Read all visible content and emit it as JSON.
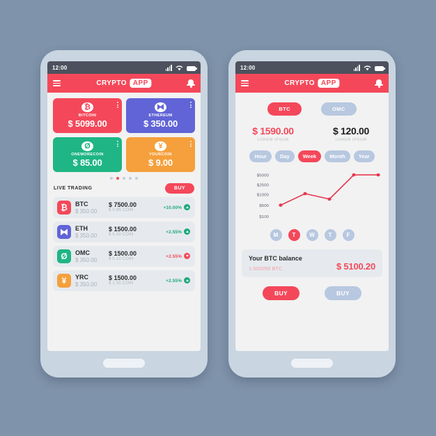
{
  "statusbar": {
    "time": "12:00",
    "signal_icon": "signal-bars-icon",
    "wifi_icon": "wifi-icon",
    "battery_icon": "battery-icon"
  },
  "header": {
    "menu_icon": "hamburger-menu-icon",
    "brand_first": "CRYPTO",
    "brand_second": "APP",
    "bell_icon": "notification-bell-icon"
  },
  "colors": {
    "accent_red": "#f4485a",
    "blue": "#b7c8e0",
    "green": "#1fa87a",
    "purple": "#6164d6",
    "orange": "#f5a03c",
    "background": "#7f93ab",
    "screen": "#f2f2f2",
    "row": "#e6eaee",
    "statusbar": "#4d515d"
  },
  "screen_one": {
    "cards": [
      {
        "name": "BITCOIN",
        "price": "$ 5099.00",
        "glyph": "₿",
        "color": "#f4485a",
        "icon": "bitcoin-icon",
        "menu_icon": "kebab-menu-icon"
      },
      {
        "name": "ETHEREUM",
        "price": "$ 350.00",
        "glyph": "⧓",
        "color": "#6164d6",
        "icon": "ethereum-icon",
        "menu_icon": "kebab-menu-icon"
      },
      {
        "name": "ONEMORECOIN",
        "price": "$ 85.00",
        "glyph": "Ø",
        "color": "#1fb584",
        "icon": "onemorecoin-icon",
        "menu_icon": "kebab-menu-icon"
      },
      {
        "name": "YOURCOIN",
        "price": "$ 9.00",
        "glyph": "¥",
        "color": "#f5a03c",
        "icon": "yourcoin-icon",
        "menu_icon": "kebab-menu-icon"
      }
    ],
    "pagination": {
      "count": 5,
      "active_index": 1
    },
    "live_trading_label": "LIVE TRADING",
    "buy_label": "BUY",
    "rows": [
      {
        "symbol": "BTC",
        "sub": "$ 350.00",
        "value": "$ 7500.00",
        "coin": "$ 0.99 COIN",
        "pct": "+10.00%",
        "dir": "up",
        "glyph": "₿",
        "color": "#f4485a",
        "icon": "bitcoin-icon"
      },
      {
        "symbol": "ETH",
        "sub": "$ 350.00",
        "value": "$ 1500.00",
        "coin": "$ 5.55 COIN",
        "pct": "+2.55%",
        "dir": "up",
        "glyph": "⧓",
        "color": "#6164d6",
        "icon": "ethereum-icon"
      },
      {
        "symbol": "OMC",
        "sub": "$ 350.00",
        "value": "$ 1500.00",
        "coin": "$ 0.10 COIN",
        "pct": "+2.55%",
        "dir": "down",
        "glyph": "Ø",
        "color": "#1fb584",
        "icon": "onemorecoin-icon"
      },
      {
        "symbol": "YRC",
        "sub": "$ 350.00",
        "value": "$ 1500.00",
        "coin": "$ 1.55 COIN",
        "pct": "+2.55%",
        "dir": "up",
        "glyph": "¥",
        "color": "#f5a03c",
        "icon": "yourcoin-icon"
      }
    ]
  },
  "screen_two": {
    "pair_tabs": [
      {
        "label": "BTC",
        "active": true
      },
      {
        "label": "OMC",
        "active": false
      }
    ],
    "prices": [
      {
        "value": "$ 1590.00",
        "label": "LOREM IPSUM",
        "accent": true
      },
      {
        "value": "$ 120.00",
        "label": "LOREM IPSUM",
        "accent": false
      }
    ],
    "periods": [
      {
        "label": "Hour",
        "active": false
      },
      {
        "label": "Day",
        "active": false
      },
      {
        "label": "Week",
        "active": true
      },
      {
        "label": "Month",
        "active": false
      },
      {
        "label": "Year",
        "active": false
      }
    ],
    "days": [
      {
        "label": "M",
        "active": false
      },
      {
        "label": "T",
        "active": true
      },
      {
        "label": "W",
        "active": false
      },
      {
        "label": "T",
        "active": false
      },
      {
        "label": "F",
        "active": false
      }
    ],
    "balance": {
      "title": "Your BTC balance",
      "subtitle": "1.000059 BTC",
      "amount": "$ 5100.20"
    },
    "actions": [
      {
        "label": "BUY",
        "style": "red"
      },
      {
        "label": "BUY",
        "style": "blue"
      }
    ]
  },
  "chart_data": {
    "type": "line",
    "title": "",
    "xlabel": "",
    "ylabel": "",
    "categories": [
      "M",
      "T",
      "W",
      "T",
      "F"
    ],
    "y_ticks": [
      "$5000",
      "$2500",
      "$1000",
      "$500",
      "$100"
    ],
    "y_tick_values": [
      5000,
      2500,
      1000,
      500,
      100
    ],
    "series": [
      {
        "name": "BTC",
        "color": "#e8384f",
        "values": [
          500,
          1200,
          900,
          5000,
          5000
        ]
      }
    ],
    "grid": false,
    "legend": "none",
    "markers": true
  }
}
